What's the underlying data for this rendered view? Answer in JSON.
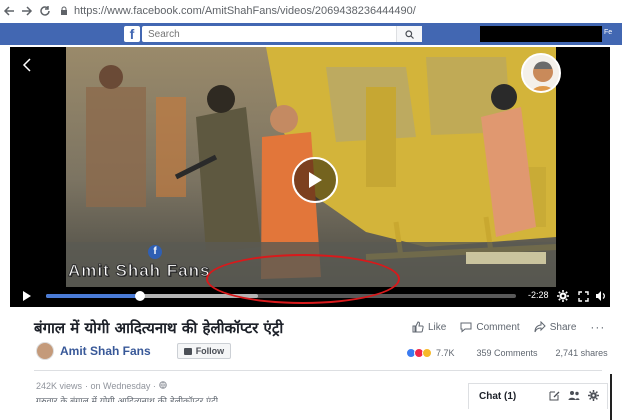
{
  "browser": {
    "url": "https://www.facebook.com/AmitShahFans/videos/2069438236444490/",
    "back_icon": "arrow-left-icon",
    "forward_icon": "arrow-right-icon",
    "reload_icon": "reload-icon"
  },
  "fb_header": {
    "logo_letter": "f",
    "search_placeholder": "Search",
    "right_partial_text": "Fe",
    "brand_color": "#4267b2"
  },
  "video": {
    "watermark_text": "Amit Shah Fans",
    "time_remaining": "-2:28",
    "progress_fraction": 0.2,
    "buffer_fraction": 0.45
  },
  "post": {
    "title": "बंगाल में योगी आदित्यनाथ की हेलीकॉप्टर एंट्री",
    "page_name": "Amit Shah Fans",
    "follow_label": "Follow",
    "actions": {
      "like": "Like",
      "comment": "Comment",
      "share": "Share",
      "more": "···"
    },
    "reaction_count": "7.7K",
    "comments": "359 Comments",
    "shares": "2,741 shares",
    "views": "242K views",
    "date": "· on Wednesday ·",
    "description": "गुरुवार के बंगाल में योगी आदित्यनाथ की हेलीकॉप्टर एंट्री"
  },
  "chat": {
    "label": "Chat (1)"
  },
  "colors": {
    "annotation": "#d9191b",
    "link": "#385898",
    "progress": "#4a7bd6"
  }
}
